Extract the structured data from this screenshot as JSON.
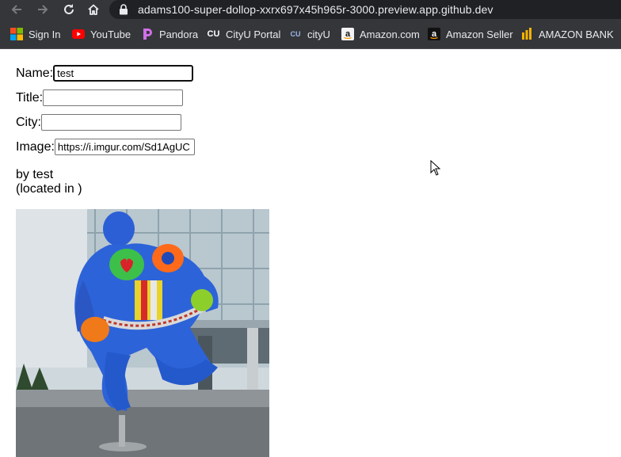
{
  "browser": {
    "url": "adams100-super-dollop-xxrx697x45h965r-3000.preview.app.github.dev",
    "bookmarks": [
      {
        "label": "Sign In",
        "icon": "microsoft-icon"
      },
      {
        "label": "YouTube",
        "icon": "youtube-icon"
      },
      {
        "label": "Pandora",
        "icon": "pandora-icon"
      },
      {
        "label": "CityU Portal",
        "icon": "cityu-icon"
      },
      {
        "label": "cityU",
        "icon": "cityu-small-icon"
      },
      {
        "label": "Amazon.com",
        "icon": "amazon-icon"
      },
      {
        "label": "Amazon Seller",
        "icon": "amazon-icon"
      },
      {
        "label": "AMAZON BANK",
        "icon": "bank-icon"
      }
    ]
  },
  "form": {
    "name_label": "Name:",
    "name_value": "test",
    "title_label": "Title:",
    "title_value": "",
    "city_label": "City:",
    "city_value": "",
    "image_label": "Image:",
    "image_value": "https://i.imgur.com/Sd1AgUC"
  },
  "preview": {
    "byline": "by test",
    "location": "(located in )",
    "image_subject": "colorful Nana sculpture"
  },
  "colors": {
    "chrome_bg": "#35363a",
    "omnibox_bg": "#202124",
    "chrome_text": "#e8eaed"
  }
}
